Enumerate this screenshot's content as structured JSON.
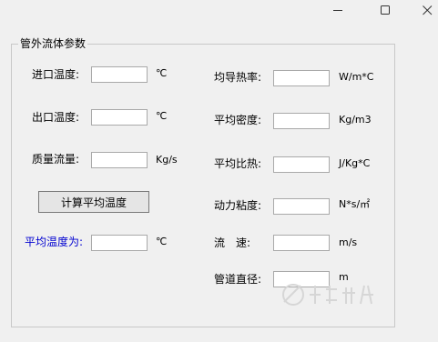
{
  "group": {
    "title": "管外流体参数"
  },
  "left": {
    "inlet_temp": {
      "label": "进口温度:",
      "value": "",
      "unit": "℃"
    },
    "outlet_temp": {
      "label": "出口温度:",
      "value": "",
      "unit": "℃"
    },
    "mass_flow": {
      "label": "质量流量:",
      "value": "",
      "unit": "Kg/s"
    },
    "calc_button": "计算平均温度",
    "avg_temp": {
      "label": "平均温度为:",
      "value": "",
      "unit": "℃"
    }
  },
  "right": {
    "thermal_conductivity": {
      "label": "均导热率:",
      "value": "",
      "unit": "W/m*C"
    },
    "avg_density": {
      "label": "平均密度:",
      "value": "",
      "unit": "Kg/m3"
    },
    "avg_specific_heat": {
      "label": "平均比热:",
      "value": "",
      "unit": "J/Kg*C"
    },
    "dynamic_viscosity": {
      "label": "动力粘度:",
      "value": "",
      "unit": "N*s/㎡"
    },
    "flow_velocity": {
      "label": "流　速:",
      "value": "",
      "unit": "m/s"
    },
    "pipe_diameter": {
      "label": "管道直径:",
      "value": "",
      "unit": "m"
    }
  },
  "colors": {
    "accent_label": "#0000d0"
  }
}
